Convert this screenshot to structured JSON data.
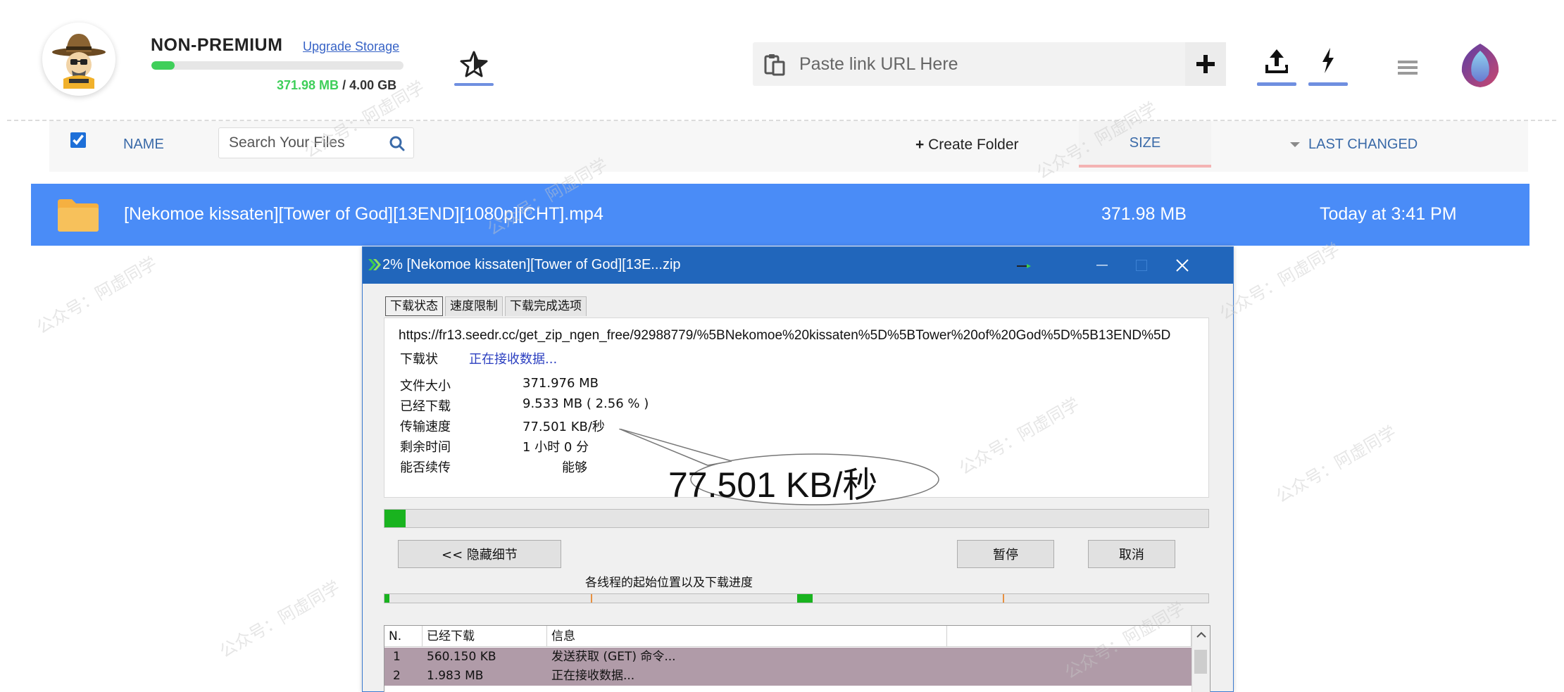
{
  "header": {
    "plan_title": "NON-PREMIUM",
    "upgrade_label": "Upgrade Storage",
    "storage_fraction": 0.091,
    "storage_used": "371.98 MB",
    "storage_total": " / 4.00 GB",
    "paste_placeholder": "Paste link URL Here",
    "icons": [
      "wizard-avatar-icon",
      "star-icon",
      "clipboard-icon",
      "plus-icon",
      "upload-icon",
      "lightning-icon",
      "hamburger-menu-icon",
      "lotus-logo-icon"
    ]
  },
  "table": {
    "name_header": "NAME",
    "search_placeholder": "Search Your Files",
    "create_folder_label": "Create Folder",
    "create_folder_prefix": "+",
    "size_header": "SIZE",
    "changed_header": "LAST CHANGED"
  },
  "file": {
    "name": "[Nekomoe kissaten][Tower of God][13END][1080p][CHT].mp4",
    "size": "371.98 MB",
    "changed": "Today at 3:41 PM"
  },
  "idm": {
    "title": "2% [Nekomoe kissaten][Tower of God][13E...zip",
    "tabs": [
      "下载状态",
      "速度限制",
      "下载完成选项"
    ],
    "url": "https://fr13.seedr.cc/get_zip_ngen_free/92988779/%5BNekomoe%20kissaten%5D%5BTower%20of%20God%5D%5B13END%5D",
    "status_label": "下载状",
    "status_value": "正在接收数据...",
    "file_size_label": "文件大小",
    "file_size_value": "371.976  MB",
    "downloaded_label": "已经下载",
    "downloaded_value": "9.533  MB  ( 2.56 % )",
    "speed_label": "传输速度",
    "speed_value": "77.501  KB/秒",
    "remaining_label": "剩余时间",
    "remaining_value": "1 小时 0 分",
    "resume_label": "能否续传",
    "resume_value": "能够",
    "callout": "77.501  KB/秒",
    "progress_fraction": 0.0256,
    "hide_details_button": "<< 隐藏细节",
    "pause_button": "暂停",
    "cancel_button": "取消",
    "threads_label": "各线程的起始位置以及下载进度",
    "columns": [
      "N.",
      "已经下载",
      "信息"
    ],
    "rows": [
      {
        "n": "1",
        "downloaded": "560.150  KB",
        "info": "发送获取 (GET) 命令..."
      },
      {
        "n": "2",
        "downloaded": "1.983  MB",
        "info": "正在接收数据..."
      }
    ]
  },
  "watermark_text": "公众号：阿虚同学",
  "colors": {
    "accent_blue": "#4a8cf7",
    "progress_green": "#3fcf5a",
    "idm_title_bar": "#2166bb",
    "idm_green": "#19b31f"
  }
}
